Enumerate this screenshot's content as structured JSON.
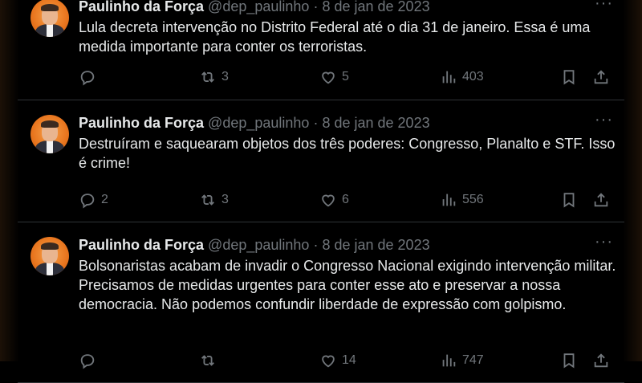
{
  "tweets": [
    {
      "name": "Paulinho da Força",
      "handle": "@dep_paulinho",
      "separator": "·",
      "date": "8 de jan de 2023",
      "text": "Lula decreta intervenção no Distrito Federal até o dia 31 de janeiro. Essa é uma medida importante para conter os terroristas.",
      "replies": "",
      "retweets": "3",
      "likes": "5",
      "views": "403"
    },
    {
      "name": "Paulinho da Força",
      "handle": "@dep_paulinho",
      "separator": "·",
      "date": "8 de jan de 2023",
      "text": "Destruíram e saquearam objetos dos três poderes: Congresso, Planalto e STF. Isso é crime!",
      "replies": "2",
      "retweets": "3",
      "likes": "6",
      "views": "556"
    },
    {
      "name": "Paulinho da Força",
      "handle": "@dep_paulinho",
      "separator": "·",
      "date": "8 de jan de 2023",
      "text": "Bolsonaristas acabam de invadir o Congresso Nacional exigindo intervenção militar. Precisamos de medidas urgentes para conter esse ato e preservar a nossa democracia. Não podemos confundir liberdade de expressão com golpismo.",
      "replies": "",
      "retweets": "",
      "likes": "14",
      "views": "747"
    }
  ],
  "more_label": "···",
  "icons": [
    "reply-icon",
    "retweet-icon",
    "like-icon",
    "views-icon",
    "bookmark-icon",
    "share-icon"
  ],
  "colors": {
    "background": "#000000",
    "text": "#e7e9ea",
    "muted": "#71767b",
    "divider": "#2f3336",
    "avatar": "#e8751e"
  }
}
